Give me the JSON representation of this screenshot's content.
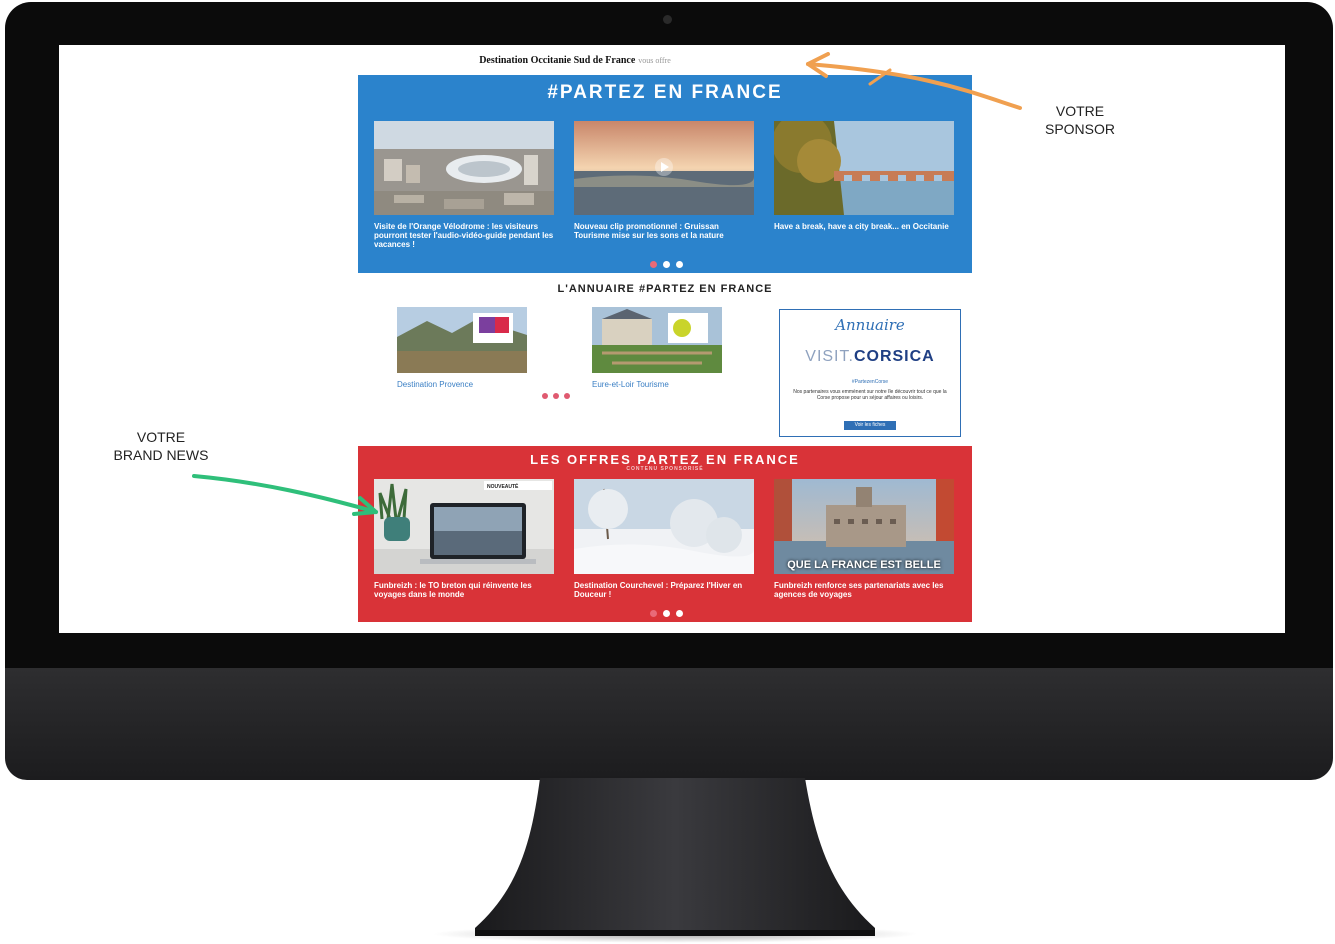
{
  "screen": {
    "sponsor": {
      "name": "Destination Occitanie Sud de France",
      "suffix": "vous offre"
    },
    "partez": {
      "title": "#PARTEZ EN FRANCE",
      "cards": [
        {
          "caption": "Visite de l'Orange Vélodrome : les visiteurs pourront tester l'audio-vidéo-guide pendant les vacances !"
        },
        {
          "caption": "Nouveau clip promotionnel : Gruissan Tourisme mise sur les sons et la nature"
        },
        {
          "caption": "Have a break, have a city break... en Occitanie"
        }
      ]
    },
    "annuaire": {
      "title": "L'ANNUAIRE #PARTEZ EN FRANCE",
      "cards": [
        {
          "caption": "Destination Provence"
        },
        {
          "caption": "Eure-et-Loir Tourisme"
        }
      ],
      "corsica": {
        "script": "Annuaire",
        "visit_a": "VISIT.",
        "visit_b": "CORSICA",
        "tag": "#PartezenCorse",
        "desc": "Nos partenaires vous emmènent sur notre île découvrir tout ce que la Corse propose pour un séjour affaires ou loisirs.",
        "button": "Voir les fiches"
      }
    },
    "offres": {
      "title": "LES OFFRES PARTEZ EN FRANCE",
      "subtitle": "CONTENU SPONSORISÉ",
      "cards": [
        {
          "caption": "Funbreizh : le TO breton qui réinvente les voyages dans le monde",
          "badge": "NOUVEAUTÉ"
        },
        {
          "caption": "Destination Courchevel : Préparez l'Hiver en Douceur !"
        },
        {
          "caption": "Funbreizh renforce ses partenariats avec les agences de voyages",
          "overlay": "QUE LA FRANCE EST BELLE"
        }
      ]
    }
  },
  "annotations": {
    "sponsor": {
      "line1": "VOTRE",
      "line2": "SPONSOR"
    },
    "brand_news": {
      "line1": "VOTRE",
      "line2": "BRAND NEWS"
    }
  },
  "colors": {
    "blue_panel": "#2b83cc",
    "red_panel": "#d93338",
    "orange_arrow": "#f0a050",
    "green_arrow": "#2fbf7a"
  }
}
